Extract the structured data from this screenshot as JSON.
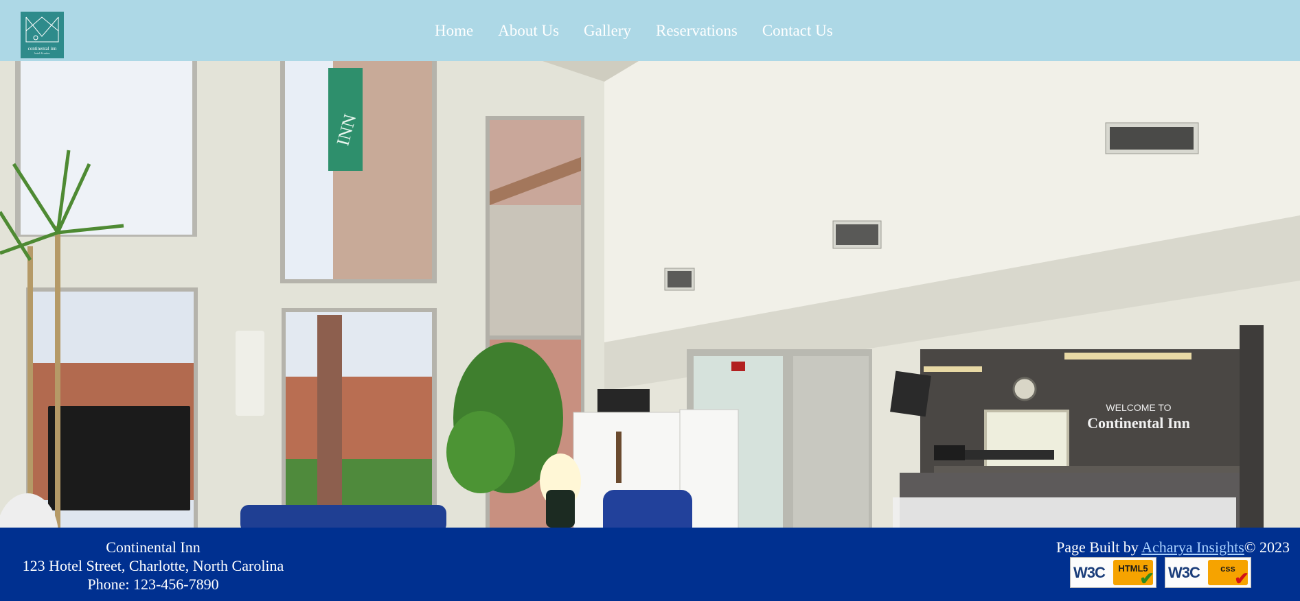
{
  "header": {
    "logo": {
      "name": "continental inn",
      "tagline": "hotel & suites"
    },
    "nav": [
      "Home",
      "About Us",
      "Gallery",
      "Reservations",
      "Contact Us"
    ]
  },
  "hero": {
    "sign_text": "INN",
    "wall_text": {
      "line1": "WELCOME TO",
      "line2": "Continental Inn"
    }
  },
  "footer": {
    "business": {
      "name": "Continental Inn",
      "address": "123 Hotel Street, Charlotte, North Carolina",
      "phone": "Phone: 123-456-7890"
    },
    "credit": {
      "prefix": "Page Built by ",
      "link": "Acharya Insights",
      "suffix": "© 2023"
    },
    "badges": [
      {
        "org": "W3C",
        "standard": "HTML5",
        "icon": "check-icon",
        "color": "#2d8b1f"
      },
      {
        "org": "W3C",
        "standard": "css",
        "icon": "check-icon",
        "color": "#d1121a"
      }
    ]
  },
  "colors": {
    "header_bg": "#add8e6",
    "footer_bg": "#003090",
    "nav_text": "#ffffff",
    "link": "#a9d1ff"
  }
}
